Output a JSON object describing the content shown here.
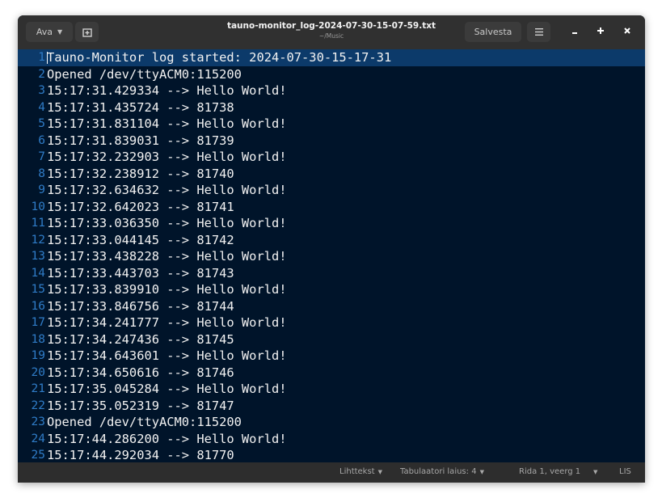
{
  "header": {
    "open_label": "Ava",
    "title": "tauno-monitor_log-2024-07-30-15-07-59.txt",
    "subtitle": "~/Music",
    "save_label": "Salvesta"
  },
  "icons": {
    "open_dropdown": "chevron-down-icon",
    "new_tab": "new-tab-icon",
    "menu": "hamburger-menu-icon",
    "minimize": "minimize-icon",
    "maximize": "maximize-icon",
    "close": "close-icon"
  },
  "editor": {
    "current_line": 1,
    "lines": [
      {
        "n": "1",
        "text": "Tauno-Monitor log started: 2024-07-30-15-17-31"
      },
      {
        "n": "2",
        "text": "Opened /dev/ttyACM0:115200"
      },
      {
        "n": "3",
        "text": "15:17:31.429334 --> Hello World!"
      },
      {
        "n": "4",
        "text": "15:17:31.435724 --> 81738"
      },
      {
        "n": "5",
        "text": "15:17:31.831104 --> Hello World!"
      },
      {
        "n": "6",
        "text": "15:17:31.839031 --> 81739"
      },
      {
        "n": "7",
        "text": "15:17:32.232903 --> Hello World!"
      },
      {
        "n": "8",
        "text": "15:17:32.238912 --> 81740"
      },
      {
        "n": "9",
        "text": "15:17:32.634632 --> Hello World!"
      },
      {
        "n": "10",
        "text": "15:17:32.642023 --> 81741"
      },
      {
        "n": "11",
        "text": "15:17:33.036350 --> Hello World!"
      },
      {
        "n": "12",
        "text": "15:17:33.044145 --> 81742"
      },
      {
        "n": "13",
        "text": "15:17:33.438228 --> Hello World!"
      },
      {
        "n": "14",
        "text": "15:17:33.443703 --> 81743"
      },
      {
        "n": "15",
        "text": "15:17:33.839910 --> Hello World!"
      },
      {
        "n": "16",
        "text": "15:17:33.846756 --> 81744"
      },
      {
        "n": "17",
        "text": "15:17:34.241777 --> Hello World!"
      },
      {
        "n": "18",
        "text": "15:17:34.247436 --> 81745"
      },
      {
        "n": "19",
        "text": "15:17:34.643601 --> Hello World!"
      },
      {
        "n": "20",
        "text": "15:17:34.650616 --> 81746"
      },
      {
        "n": "21",
        "text": "15:17:35.045284 --> Hello World!"
      },
      {
        "n": "22",
        "text": "15:17:35.052319 --> 81747"
      },
      {
        "n": "23",
        "text": "Opened /dev/ttyACM0:115200"
      },
      {
        "n": "24",
        "text": "15:17:44.286200 --> Hello World!"
      },
      {
        "n": "25",
        "text": "15:17:44.292034 --> 81770"
      }
    ]
  },
  "statusbar": {
    "language": "Lihttekst",
    "tab_width": "Tabulaatori laius: 4",
    "position": "Rida 1, veerg 1",
    "mode": "LIS"
  },
  "colors": {
    "editor_bg": "#00142a",
    "current_line_bg": "#0c3a6a",
    "line_number": "#2f7cc7",
    "text": "#f2f2f2",
    "headerbar_bg": "#303030",
    "statusbar_bg": "#2d2d2d"
  }
}
